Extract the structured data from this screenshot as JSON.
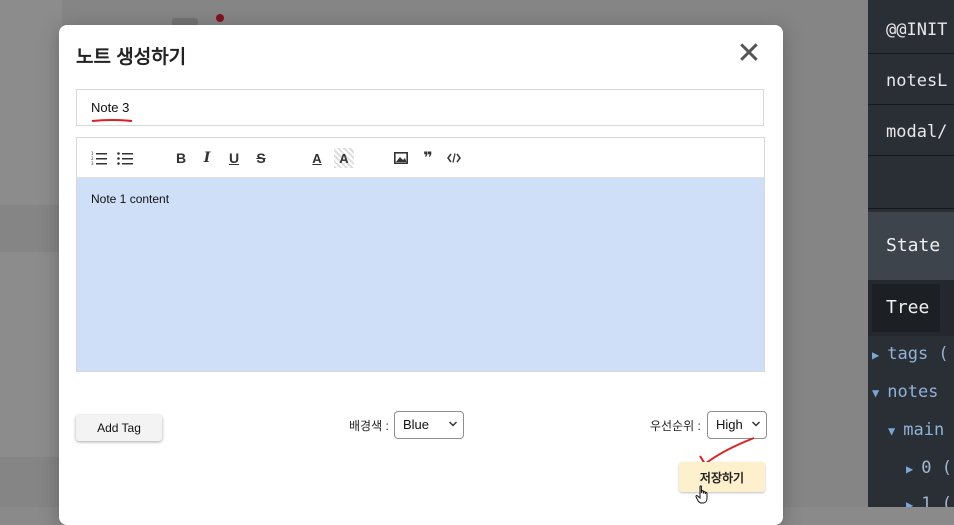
{
  "modal": {
    "title": "노트 생성하기",
    "close_glyph": "✕",
    "title_input_value": "Note 3",
    "content_text": "Note 1 content",
    "add_tag_label": "Add Tag",
    "bg_color_label": "배경색 :",
    "bg_color_value": "Blue",
    "priority_label": "우선순위 :",
    "priority_value": "High",
    "save_label": "저장하기"
  },
  "toolbar": {
    "buttons": [
      "ordered-list",
      "bullet-list",
      "bold",
      "italic",
      "underline",
      "strike",
      "font-color",
      "background-color",
      "image",
      "blockquote",
      "code-block"
    ],
    "bold_glyph": "B",
    "italic_glyph": "I",
    "underline_glyph": "U",
    "strike_glyph": "S",
    "color_glyph": "A",
    "bgcolor_glyph": "A",
    "quote_glyph": "❞"
  },
  "devtools": {
    "actions": [
      "@@INIT",
      "notesL",
      "modal/"
    ],
    "state_label": "State",
    "tree_tab": "Tree",
    "tree": [
      {
        "arrow": "▶",
        "label": "tags ("
      },
      {
        "arrow": "▼",
        "label": "notes"
      },
      {
        "arrow": "▼",
        "label": "main"
      },
      {
        "arrow": "▶",
        "label": "0 ("
      },
      {
        "arrow": "▶",
        "label": "1 ("
      }
    ]
  },
  "colors": {
    "editor_bg": "#cfdff8",
    "save_button": "#fdf0cc",
    "annotation_red": "#e02020",
    "devtools_bg": "#2a2f36"
  }
}
